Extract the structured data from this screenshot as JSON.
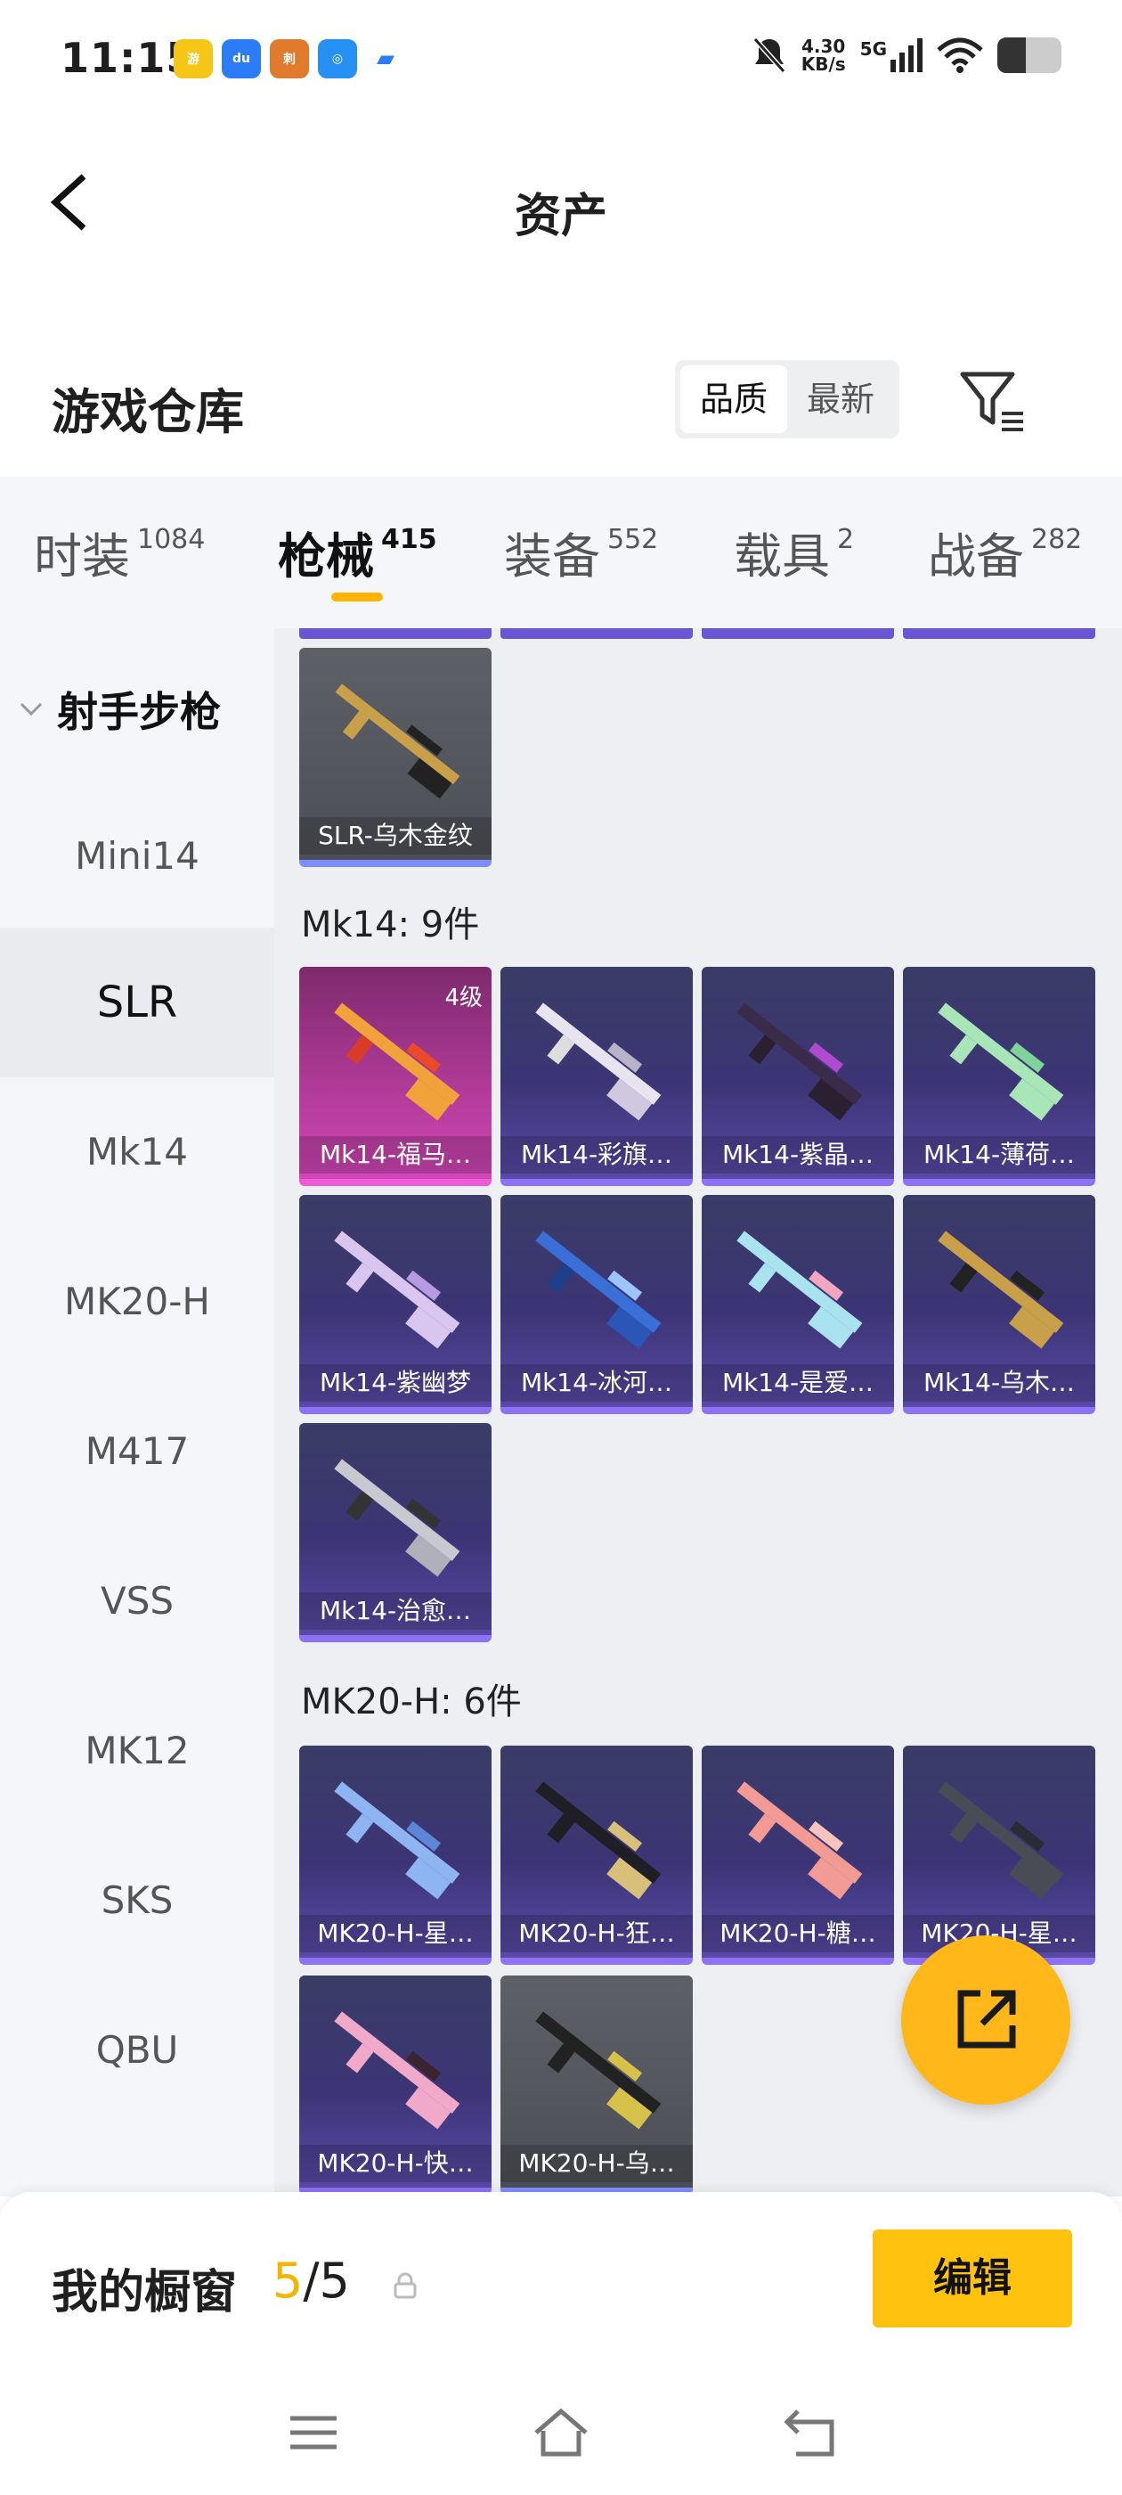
{
  "status_bar": {
    "time": "11:15",
    "net_speed_value": "4.30",
    "net_speed_unit": "KB/s",
    "network": "5G",
    "battery_level": 0.45
  },
  "header": {
    "back_icon": "chevron-left-icon",
    "title": "资产"
  },
  "section": {
    "title": "游戏仓库",
    "sort_options": [
      "品质",
      "最新"
    ],
    "sort_active": "品质",
    "filter_icon": "filter-icon"
  },
  "tabs": [
    {
      "label": "时装",
      "count": "1084"
    },
    {
      "label": "枪械",
      "count": "415"
    },
    {
      "label": "装备",
      "count": "552"
    },
    {
      "label": "载具",
      "count": "2"
    },
    {
      "label": "战备",
      "count": "282"
    }
  ],
  "active_tab": "枪械",
  "sidebar": {
    "group": "射手步枪",
    "items": [
      "Mini14",
      "SLR",
      "Mk14",
      "MK20-H",
      "M417",
      "VSS",
      "MK12",
      "SKS",
      "QBU"
    ],
    "active": "SLR"
  },
  "content": {
    "slr_item": {
      "name": "SLR-乌木金纹",
      "rarity": "grey"
    },
    "mk14": {
      "label": "Mk14: 9件",
      "items": [
        {
          "name": "Mk14-福马…",
          "rarity": "pink",
          "level": "4级"
        },
        {
          "name": "Mk14-彩旗…",
          "rarity": "purple"
        },
        {
          "name": "Mk14-紫晶…",
          "rarity": "purple"
        },
        {
          "name": "Mk14-薄荷…",
          "rarity": "purple"
        },
        {
          "name": "Mk14-紫幽梦",
          "rarity": "purple"
        },
        {
          "name": "Mk14-冰河…",
          "rarity": "purple"
        },
        {
          "name": "Mk14-是爱…",
          "rarity": "purple"
        },
        {
          "name": "Mk14-乌木…",
          "rarity": "purple"
        },
        {
          "name": "Mk14-治愈…",
          "rarity": "purple"
        }
      ]
    },
    "mk20": {
      "label": "MK20-H: 6件",
      "items": [
        {
          "name": "MK20-H-星…",
          "rarity": "purple"
        },
        {
          "name": "MK20-H-狂…",
          "rarity": "purple"
        },
        {
          "name": "MK20-H-糖…",
          "rarity": "purple"
        },
        {
          "name": "MK20-H-星…",
          "rarity": "purple"
        },
        {
          "name": "MK20-H-快…",
          "rarity": "purple"
        },
        {
          "name": "MK20-H-乌…",
          "rarity": "grey"
        }
      ]
    }
  },
  "fab": {
    "icon": "share-external-icon"
  },
  "showcase": {
    "label": "我的橱窗",
    "current": "5",
    "total": "/5",
    "lock_icon": "lock-icon",
    "edit_label": "编辑"
  },
  "nav": {
    "icons": [
      "menu-icon",
      "home-icon",
      "back-icon"
    ]
  },
  "colors": {
    "accent": "#ffb400",
    "button": "#ffc20e",
    "purple_rarity": "#8e72f5",
    "pink_rarity": "#f05ad4"
  }
}
